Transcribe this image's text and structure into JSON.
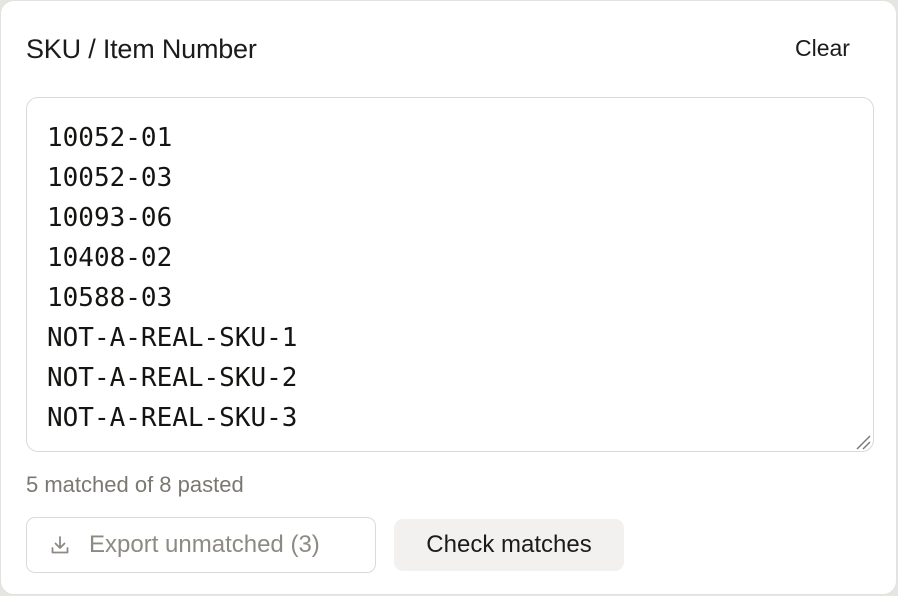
{
  "panel": {
    "title": "SKU / Item Number",
    "clear_label": "Clear"
  },
  "sku_input": {
    "value": "10052-01\n10052-03\n10093-06\n10408-02\n10588-03\nNOT-A-REAL-SKU-1\nNOT-A-REAL-SKU-2\nNOT-A-REAL-SKU-3"
  },
  "status": {
    "text": "5 matched of 8 pasted"
  },
  "actions": {
    "export_label": "Export unmatched (3)",
    "export_icon": "download-icon",
    "check_label": "Check matches"
  }
}
